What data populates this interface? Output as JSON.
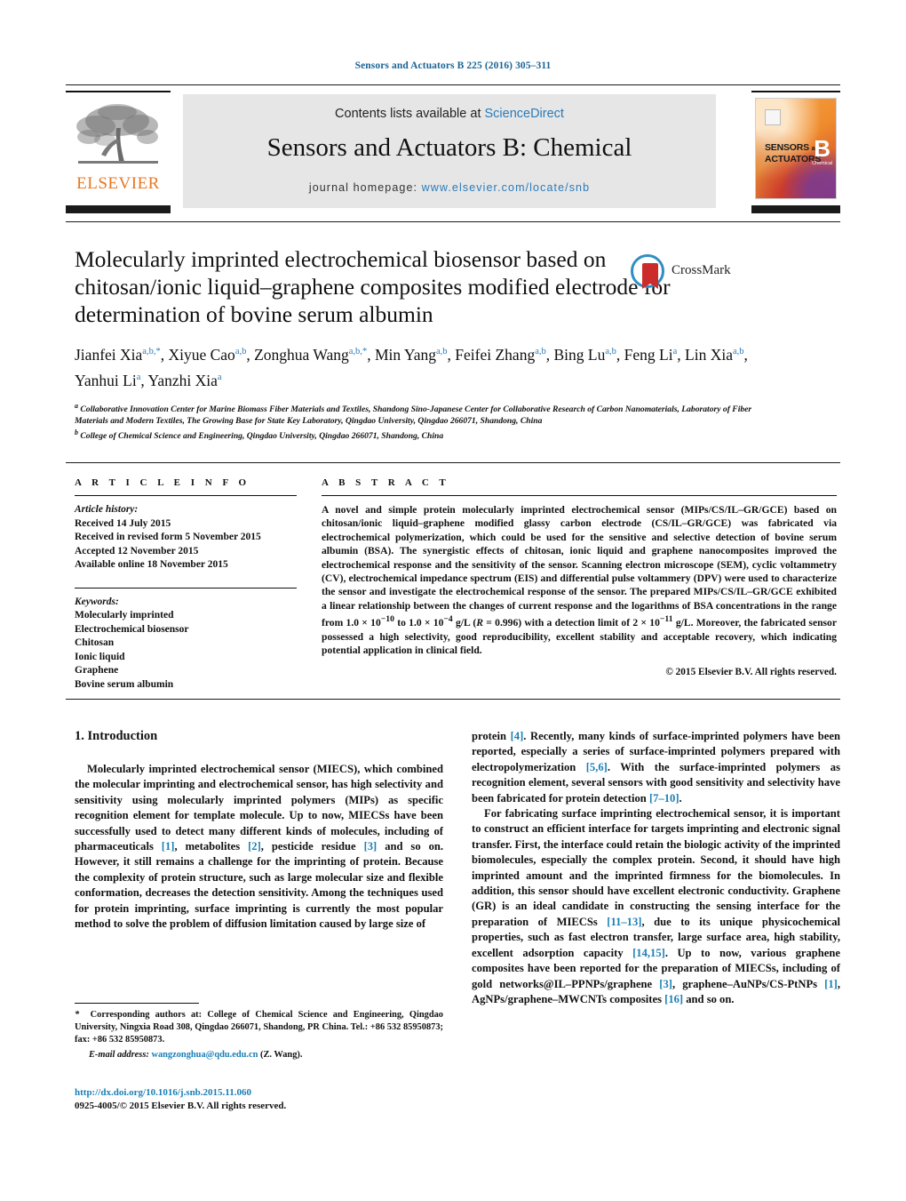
{
  "running_head": "Sensors and Actuators B 225 (2016) 305–311",
  "masthead": {
    "contents_prefix": "Contents lists available at ",
    "sciencedirect": "ScienceDirect",
    "journal_title": "Sensors and Actuators B: Chemical",
    "homepage_label": "journal homepage: ",
    "homepage_url": "www.elsevier.com/locate/snb",
    "publisher_logo_text": "ELSEVIER",
    "cover": {
      "line1": "SENSORS",
      "and": "and",
      "line2": "ACTUATORS",
      "series": "B",
      "subtitle": "Chemical"
    },
    "accent_blue": "#2b7bb9",
    "elsevier_orange": "#E87722",
    "banner_gray": "#e6e6e6"
  },
  "article": {
    "title": "Molecularly imprinted electrochemical biosensor based on chitosan/ionic liquid–graphene composites modified electrode for determination of bovine serum albumin",
    "crossmark_label": "CrossMark",
    "authors_html": "Jianfei Xia<sup>a,b,</sup><sup>*</sup>, Xiyue Cao<sup>a,b</sup>, Zonghua Wang<sup>a,b,</sup><sup>*</sup>, Min Yang<sup>a,b</sup>, Feifei Zhang<sup>a,b</sup>, Bing Lu<sup>a,b</sup>, Feng Li<sup>a</sup>, Lin Xia<sup>a,b</sup>, Yanhui Li<sup>a</sup>, Yanzhi Xia<sup>a</sup>",
    "affiliation_a": "Collaborative Innovation Center for Marine Biomass Fiber Materials and Textiles, Shandong Sino-Japanese Center for Collaborative Research of Carbon Nanomaterials, Laboratory of Fiber Materials and Modern Textiles, The Growing Base for State Key Laboratory, Qingdao University, Qingdao 266071, Shandong, China",
    "affiliation_b": "College of Chemical Science and Engineering, Qingdao University, Qingdao 266071, Shandong, China"
  },
  "article_info": {
    "heading": "A R T I C L E  I N F O",
    "history_label": "Article history:",
    "history": [
      "Received 14 July 2015",
      "Received in revised form 5 November 2015",
      "Accepted 12 November 2015",
      "Available online 18 November 2015"
    ],
    "keywords_label": "Keywords:",
    "keywords": [
      "Molecularly imprinted",
      "Electrochemical biosensor",
      "Chitosan",
      "Ionic liquid",
      "Graphene",
      "Bovine serum albumin"
    ]
  },
  "abstract": {
    "heading": "A B S T R A C T",
    "text_html": "A novel and simple protein molecularly imprinted electrochemical sensor (MIPs/CS/IL–GR/GCE) based on chitosan/ionic liquid–graphene modified glassy carbon electrode (CS/IL–GR/GCE) was fabricated via electrochemical polymerization, which could be used for the sensitive and selective detection of bovine serum albumin (BSA). The synergistic effects of chitosan, ionic liquid and graphene nanocomposites improved the electrochemical response and the sensitivity of the sensor. Scanning electron microscope (SEM), cyclic voltammetry (CV), electrochemical impedance spectrum (EIS) and differential pulse voltammery (DPV) were used to characterize the sensor and investigate the electrochemical response of the sensor. The prepared MIPs/CS/IL–GR/GCE exhibited a linear relationship between the changes of current response and the logarithms of BSA concentrations in the range from 1.0 × 10<sup>−10</sup> to 1.0 × 10<sup>−4</sup> g/L (<i>R</i> = 0.996) with a detection limit of 2 × 10<sup>−11</sup> g/L. Moreover, the fabricated sensor possessed a high selectivity, good reproducibility, excellent stability and acceptable recovery, which indicating potential application in clinical field.",
    "copyright": "© 2015 Elsevier B.V. All rights reserved."
  },
  "body": {
    "section_heading": "1. Introduction",
    "left_paragraph_html": "Molecularly imprinted electrochemical sensor (MIECS), which combined the molecular imprinting and electrochemical sensor, has high selectivity and sensitivity using molecularly imprinted polymers (MIPs) as specific recognition element for template molecule. Up to now, MIECSs have been successfully used to detect many different kinds of molecules, including of pharmaceuticals <span class=\"ref\">[1]</span>, metabolites <span class=\"ref\">[2]</span>, pesticide residue <span class=\"ref\">[3]</span> and so on. However, it still remains a challenge for the imprinting of protein. Because the complexity of protein structure, such as large molecular size and flexible conformation, decreases the detection sensitivity. Among the techniques used for protein imprinting, surface imprinting is currently the most popular method to solve the problem of diffusion limitation caused by large size of",
    "right_paragraph_1_html": "protein <span class=\"ref\">[4]</span>. Recently, many kinds of surface-imprinted polymers have been reported, especially a series of surface-imprinted polymers prepared with electropolymerization <span class=\"ref\">[5,6]</span>. With the surface-imprinted polymers as recognition element, several sensors with good sensitivity and selectivity have been fabricated for protein detection <span class=\"ref\">[7–10]</span>.",
    "right_paragraph_2_html": "For fabricating surface imprinting electrochemical sensor, it is important to construct an efficient interface for targets imprinting and electronic signal transfer. First, the interface could retain the biologic activity of the imprinted biomolecules, especially the complex protein. Second, it should have high imprinted amount and the imprinted firmness for the biomolecules. In addition, this sensor should have excellent electronic conductivity. Graphene (GR) is an ideal candidate in constructing the sensing interface for the preparation of MIECSs <span class=\"ref\">[11–13]</span>, due to its unique physicochemical properties, such as fast electron transfer, large surface area, high stability, excellent adsorption capacity <span class=\"ref\">[14,15]</span>. Up to now, various graphene composites have been reported for the preparation of MIECSs, including of gold networks@IL–PPNPs/graphene <span class=\"ref\">[3]</span>, graphene–AuNPs/CS-PtNPs <span class=\"ref\">[1]</span>, AgNPs/graphene–MWCNTs composites <span class=\"ref\">[16]</span> and so on."
  },
  "footnotes": {
    "corresponding_html": "<span class=\"em\">*</span>&nbsp; Corresponding authors at: College of Chemical Science and Engineering, Qingdao University, Ningxia Road 308, Qingdao 266071, Shandong, PR China. Tel.: +86 532 85950873; fax: +86 532 85950873.",
    "email_html": "<span class=\"em\">E-mail address:</span> <span class=\"mail\">wangzonghua@qdu.edu.cn</span> (Z. Wang).",
    "doi": "http://dx.doi.org/10.1016/j.snb.2015.11.060",
    "issn_line": "0925-4005/© 2015 Elsevier B.V. All rights reserved."
  }
}
